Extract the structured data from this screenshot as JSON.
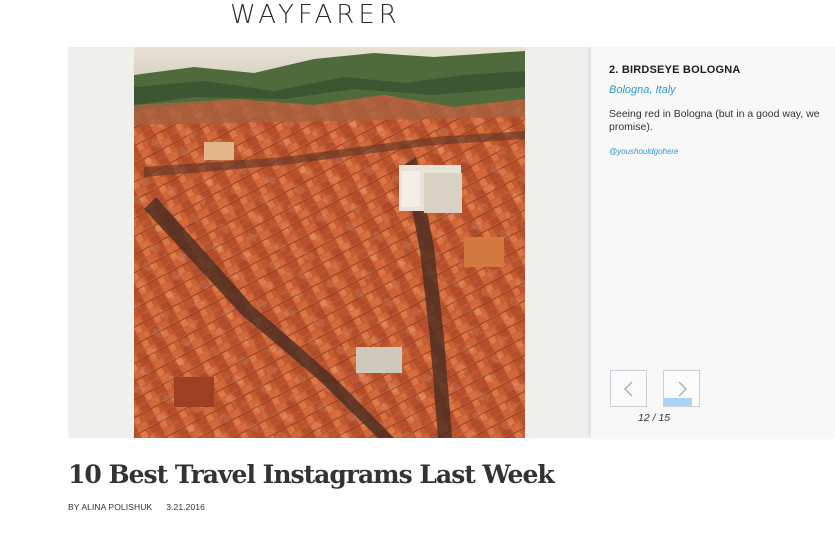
{
  "site": {
    "brand": "WAYFARER"
  },
  "gallery": {
    "image_alt": "Aerial view of Bologna rooftops",
    "caption": {
      "title": "2. BIRDSEYE BOLOGNA",
      "location": "Bologna, Italy",
      "description": "Seeing red in Bologna (but in a good way, we promise).",
      "handle": "@youshouldgohere"
    },
    "nav": {
      "prev_icon": "chevron-left-icon",
      "next_icon": "chevron-right-icon"
    },
    "counter": "12 / 15",
    "next_button_progress": 0.8
  },
  "article": {
    "headline": "10 Best Travel Instagrams Last Week",
    "byline": "BY ALINA POLISHUK",
    "date": "3.21.2016"
  },
  "colors": {
    "accent": "#2d9bd1",
    "progress": "#a9d2f3"
  }
}
